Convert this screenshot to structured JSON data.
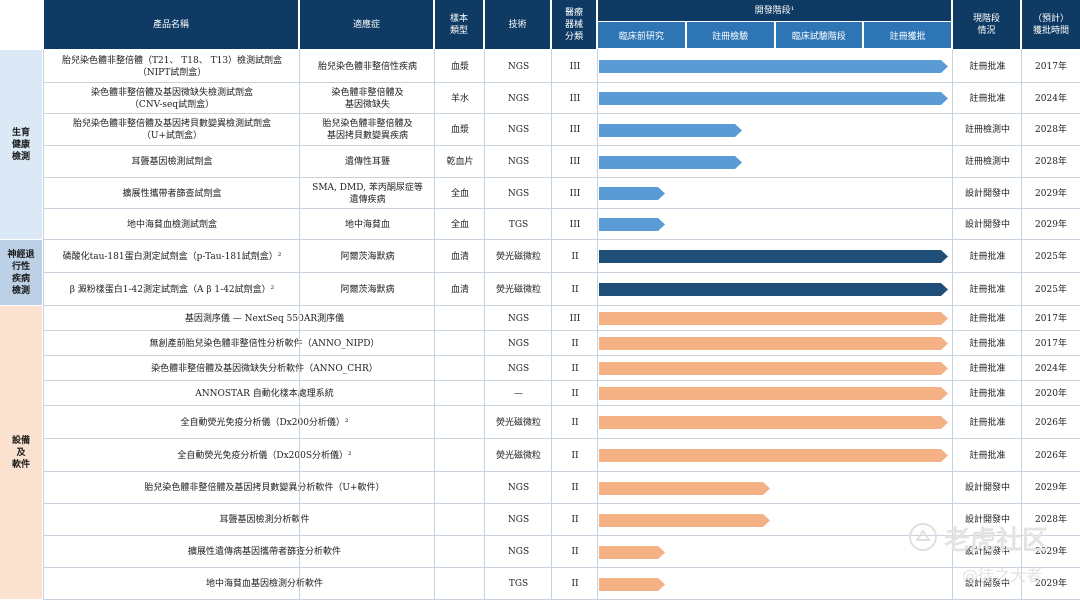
{
  "headers": {
    "product": "產品名稱",
    "indication": "適應症",
    "sample_type": "樣本\n類型",
    "technology": "技術",
    "device_class": "醫療\n器械\n分類",
    "dev_stage": "開發階段¹",
    "current_status": "現階段\n情況",
    "approval_time": "（預計）\n獲批時間"
  },
  "stages": [
    "臨床前研究",
    "註冊檢驗",
    "臨床試驗階段",
    "註冊獲批"
  ],
  "categories": [
    {
      "label": "生育\n健康\n檢測",
      "color": "#dbe9f6"
    },
    {
      "label": "神經退\n行性\n疾病\n檢測",
      "color": "#bcd0e6"
    },
    {
      "label": "設備\n及\n軟件",
      "color": "#fbe1cf"
    }
  ],
  "colors": {
    "light_blue": "#5b9bd5",
    "dark_blue": "#1f4e79",
    "orange": "#f4b183"
  },
  "rows": [
    {
      "product": "胎兒染色體非整倍體（T21、 T18、 T13）檢測試劑盒\n（NIPT試劑盒）",
      "indication": "胎兒染色體非整倍性疾病",
      "sample": "血漿",
      "tech": "NGS",
      "cls": "III",
      "progress": 1.0,
      "color": "light_blue",
      "status": "註冊批准",
      "time": "2017年"
    },
    {
      "product": "染色體非整倍體及基因微缺失檢測試劑盒\n（CNV-seq試劑盒）",
      "indication": "染色體非整倍體及\n基因微缺失",
      "sample": "羊水",
      "tech": "NGS",
      "cls": "III",
      "progress": 1.0,
      "color": "light_blue",
      "status": "註冊批准",
      "time": "2024年"
    },
    {
      "product": "胎兒染色體非整倍體及基因拷貝數變異檢測試劑盒\n（U+試劑盒）",
      "indication": "胎兒染色體非整倍體及\n基因拷貝數變異疾病",
      "sample": "血漿",
      "tech": "NGS",
      "cls": "III",
      "progress": 0.41,
      "color": "light_blue",
      "status": "註冊檢測中",
      "time": "2028年"
    },
    {
      "product": "耳聾基因檢測試劑盒",
      "indication": "遺傳性耳聾",
      "sample": "乾血片",
      "tech": "NGS",
      "cls": "III",
      "progress": 0.41,
      "color": "light_blue",
      "status": "註冊檢測中",
      "time": "2028年"
    },
    {
      "product": "擴展性攜帶者篩查試劑盒",
      "indication": "SMA, DMD, 苯丙酮尿症等\n遺傳疾病",
      "sample": "全血",
      "tech": "NGS",
      "cls": "III",
      "progress": 0.19,
      "color": "light_blue",
      "status": "設計開發中",
      "time": "2029年"
    },
    {
      "product": "地中海貧血檢測試劑盒",
      "indication": "地中海貧血",
      "sample": "全血",
      "tech": "TGS",
      "cls": "III",
      "progress": 0.19,
      "color": "light_blue",
      "status": "設計開發中",
      "time": "2029年"
    },
    {
      "product": "磷酸化tau-181蛋白測定試劑盒（p-Tau-181試劑盒）²",
      "indication": "阿爾茨海默病",
      "sample": "血清",
      "tech": "熒光磁微粒",
      "cls": "II",
      "progress": 1.0,
      "color": "dark_blue",
      "status": "註冊批准",
      "time": "2025年"
    },
    {
      "product": "β 澱粉樣蛋白1-42測定試劑盒（A β 1-42試劑盒）²",
      "indication": "阿爾茨海默病",
      "sample": "血清",
      "tech": "熒光磁微粒",
      "cls": "II",
      "progress": 1.0,
      "color": "dark_blue",
      "status": "註冊批准",
      "time": "2025年"
    },
    {
      "product": "基因測序儀 — NextSeq 550AR測序儀",
      "indication": "",
      "sample": "",
      "tech": "NGS",
      "cls": "III",
      "progress": 1.0,
      "color": "orange",
      "status": "註冊批准",
      "time": "2017年"
    },
    {
      "product": "無創產前胎兒染色體非整倍性分析軟件（ANNO_NIPD）",
      "indication": "",
      "sample": "",
      "tech": "NGS",
      "cls": "II",
      "progress": 1.0,
      "color": "orange",
      "status": "註冊批准",
      "time": "2017年"
    },
    {
      "product": "染色體非整倍體及基因微缺失分析軟件（ANNO_CHR）",
      "indication": "",
      "sample": "",
      "tech": "NGS",
      "cls": "II",
      "progress": 1.0,
      "color": "orange",
      "status": "註冊批准",
      "time": "2024年"
    },
    {
      "product": "ANNOSTAR 自動化樣本處理系統",
      "indication": "",
      "sample": "",
      "tech": "—",
      "cls": "II",
      "progress": 1.0,
      "color": "orange",
      "status": "註冊批准",
      "time": "2020年"
    },
    {
      "product": "全自動熒光免疫分析儀（Dx200分析儀）²",
      "indication": "",
      "sample": "",
      "tech": "熒光磁微粒",
      "cls": "II",
      "progress": 1.0,
      "color": "orange",
      "status": "註冊批准",
      "time": "2026年"
    },
    {
      "product": "全自動熒光免疫分析儀（Dx200S分析儀）²",
      "indication": "",
      "sample": "",
      "tech": "熒光磁微粒",
      "cls": "II",
      "progress": 1.0,
      "color": "orange",
      "status": "註冊批准",
      "time": "2026年"
    },
    {
      "product": "胎兒染色體非整倍體及基因拷貝數變異分析軟件（U+軟件）",
      "indication": "",
      "sample": "",
      "tech": "NGS",
      "cls": "II",
      "progress": 0.49,
      "color": "orange",
      "status": "設計開發中",
      "time": "2029年"
    },
    {
      "product": "耳聾基因檢測分析軟件",
      "indication": "",
      "sample": "",
      "tech": "NGS",
      "cls": "II",
      "progress": 0.49,
      "color": "orange",
      "status": "設計開發中",
      "time": "2028年"
    },
    {
      "product": "擴展性遺傳病基因攜帶者篩查分析軟件",
      "indication": "",
      "sample": "",
      "tech": "NGS",
      "cls": "II",
      "progress": 0.19,
      "color": "orange",
      "status": "設計開發中",
      "time": "2029年"
    },
    {
      "product": "地中海貧血基因檢測分析軟件",
      "indication": "",
      "sample": "",
      "tech": "TGS",
      "cls": "II",
      "progress": 0.19,
      "color": "orange",
      "status": "設計開發中",
      "time": "2029年"
    }
  ],
  "watermark": {
    "site": "老虎社区",
    "user": "@徒之大者"
  }
}
